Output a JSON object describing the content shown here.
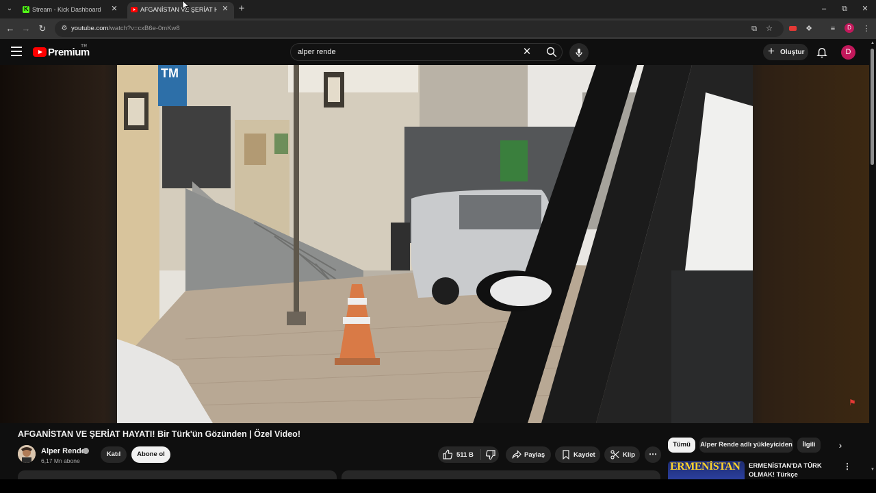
{
  "browser": {
    "tabs": [
      {
        "title": "Stream - Kick Dashboard",
        "favicon": "kick-icon",
        "color": "#53fc18"
      },
      {
        "title": "AFGANİSTAN VE ŞERİAT HAYATI",
        "favicon": "youtube-icon",
        "color": "#ff0000",
        "active": true
      }
    ],
    "url_host": "youtube.com",
    "url_path": "/watch?v=cxB6e-0mKw8",
    "profile_initial": "D"
  },
  "youtube": {
    "logo_text": "Premium",
    "country_code": "TR",
    "search_query": "alper rende",
    "create_label": "Oluştur",
    "avatar_initial": "D"
  },
  "video": {
    "title": "AFGANİSTAN VE ŞERİAT HAYATI! Bir Türk'ün Gözünden | Özel Video!",
    "channel_name": "Alper Rende",
    "subscribers": "6,17 Mn abone",
    "join_label": "Katıl",
    "subscribe_label": "Abone ol",
    "like_count": "511 B",
    "actions": {
      "share": "Paylaş",
      "save": "Kaydet",
      "clip": "Klip"
    },
    "frame_sign": "TM"
  },
  "sidebar": {
    "chips": [
      "Tümü",
      "Alper Rende adlı yükleyiciden",
      "İlgili"
    ],
    "active_chip": "Tümü",
    "recommendation": {
      "thumb_text": "ERMENİSTAN",
      "title": "ERMENİSTAN'DA TÜRK OLMAK! Türkçe konuştuğumuzu duyan"
    }
  },
  "colors": {
    "accent_red": "#ff0000",
    "avatar_pink": "#c2185b",
    "background": "#0f0f0f"
  }
}
